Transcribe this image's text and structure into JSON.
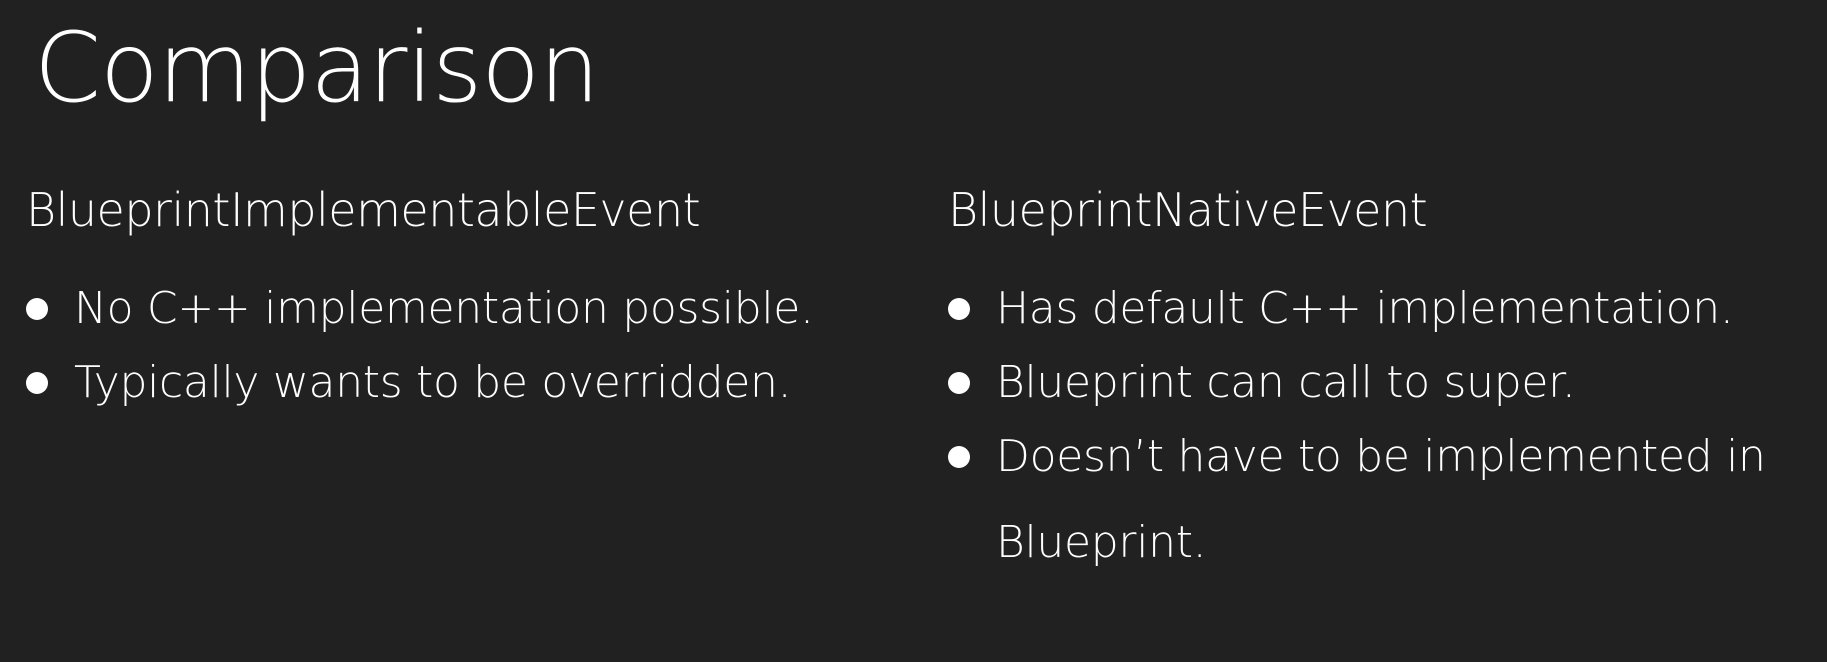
{
  "title": "Comparison",
  "left": {
    "heading": "BlueprintImplementableEvent",
    "bullets": [
      "No C++ implementation possible.",
      "Typically wants to be overridden."
    ]
  },
  "right": {
    "heading": "BlueprintNativeEvent",
    "bullets": [
      "Has default C++ implementation.",
      "Blueprint can call to super.",
      "Doesn’t have to be implemented in Blueprint."
    ]
  }
}
